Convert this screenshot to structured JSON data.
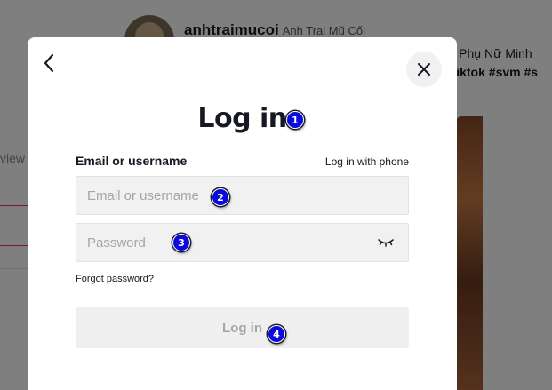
{
  "background": {
    "username": "anhtraimucoi",
    "nickname": "Anh Trai Mũ Cối",
    "caption_line1": "ời Phụ Nữ Minh",
    "caption_line2": "gtiktok #svm #s",
    "left_text": "view"
  },
  "modal": {
    "title": "Log in",
    "field_label": "Email or username",
    "phone_link": "Log in with phone",
    "email_placeholder": "Email or username",
    "email_value": "",
    "password_placeholder": "Password",
    "password_value": "",
    "forgot": "Forgot password?",
    "submit": "Log in"
  },
  "markers": [
    "1",
    "2",
    "3",
    "4"
  ],
  "colors": {
    "accent": "#fe2c55",
    "marker": "#0a0adb",
    "field_bg": "#f1f1f2",
    "disabled_text": "#a6a6ab"
  },
  "icons": {
    "back": "chevron-left-icon",
    "close": "close-icon",
    "password_toggle": "eye-closed-icon"
  }
}
